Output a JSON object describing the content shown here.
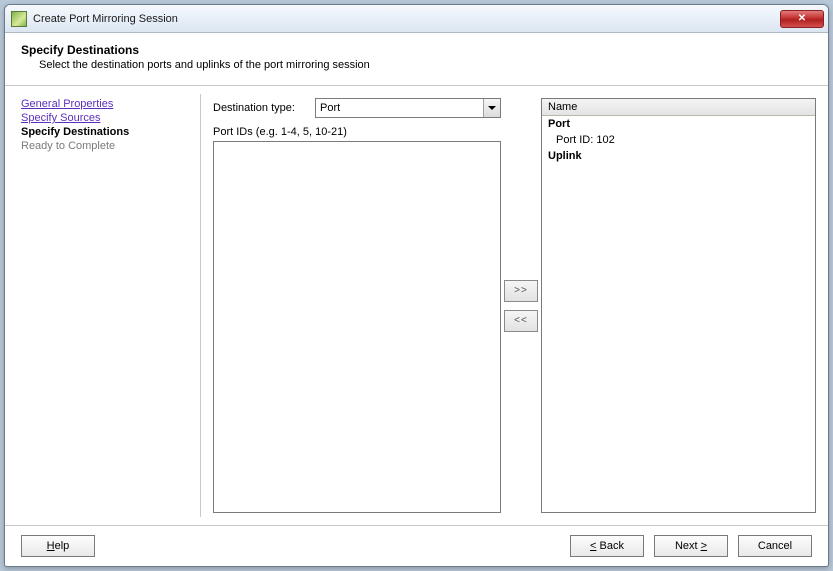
{
  "window": {
    "title": "Create Port Mirroring Session"
  },
  "header": {
    "title": "Specify Destinations",
    "subtitle": "Select the destination ports and uplinks of the port mirroring session"
  },
  "nav": {
    "step1": "General Properties",
    "step2": "Specify Sources",
    "step3": "Specify Destinations",
    "step4": "Ready to Complete"
  },
  "form": {
    "dest_type_label": "Destination type:",
    "dest_type_value": "Port",
    "port_ids_label": "Port IDs (e.g. 1-4, 5, 10-21)"
  },
  "transfer": {
    "add": ">>",
    "remove": "<<"
  },
  "table": {
    "col_name": "Name",
    "rows": {
      "port_header": "Port",
      "port_id": "Port ID: 102",
      "uplink_header": "Uplink"
    }
  },
  "footer": {
    "help": "Help",
    "back": "< Back",
    "next": "Next >",
    "cancel": "Cancel"
  }
}
